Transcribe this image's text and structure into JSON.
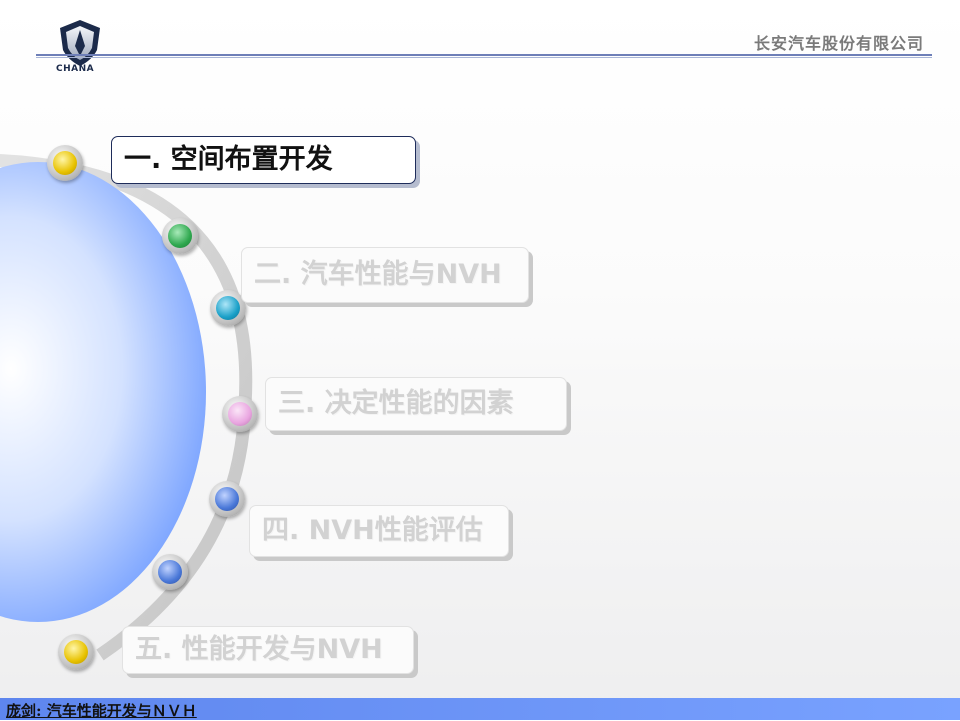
{
  "header": {
    "logo_text": "CHANA",
    "company": "长安汽车股份有限公司"
  },
  "menu": [
    {
      "label": "一.  空间布置开发",
      "state": "active"
    },
    {
      "label": "二. 汽车性能与NVH",
      "state": "inactive"
    },
    {
      "label": "三. 决定性能的因素",
      "state": "inactive"
    },
    {
      "label": "四. NVH性能评估",
      "state": "inactive"
    },
    {
      "label": "五. 性能开发与NVH",
      "state": "inactive"
    }
  ],
  "decor_dots": [
    "yellow",
    "green",
    "teal",
    "pink",
    "blue",
    "blue",
    "yellow"
  ],
  "colors": {
    "yellow": "#e8c200",
    "green": "#2fa84f",
    "teal": "#1aa0c8",
    "pink": "#e9a5e0",
    "blue": "#4a78d8",
    "accent_line": "#6e7fb8",
    "footer": "#6b93f5"
  },
  "footer": {
    "text": "庞剑: 汽车性能开发与ＮＶＨ"
  }
}
